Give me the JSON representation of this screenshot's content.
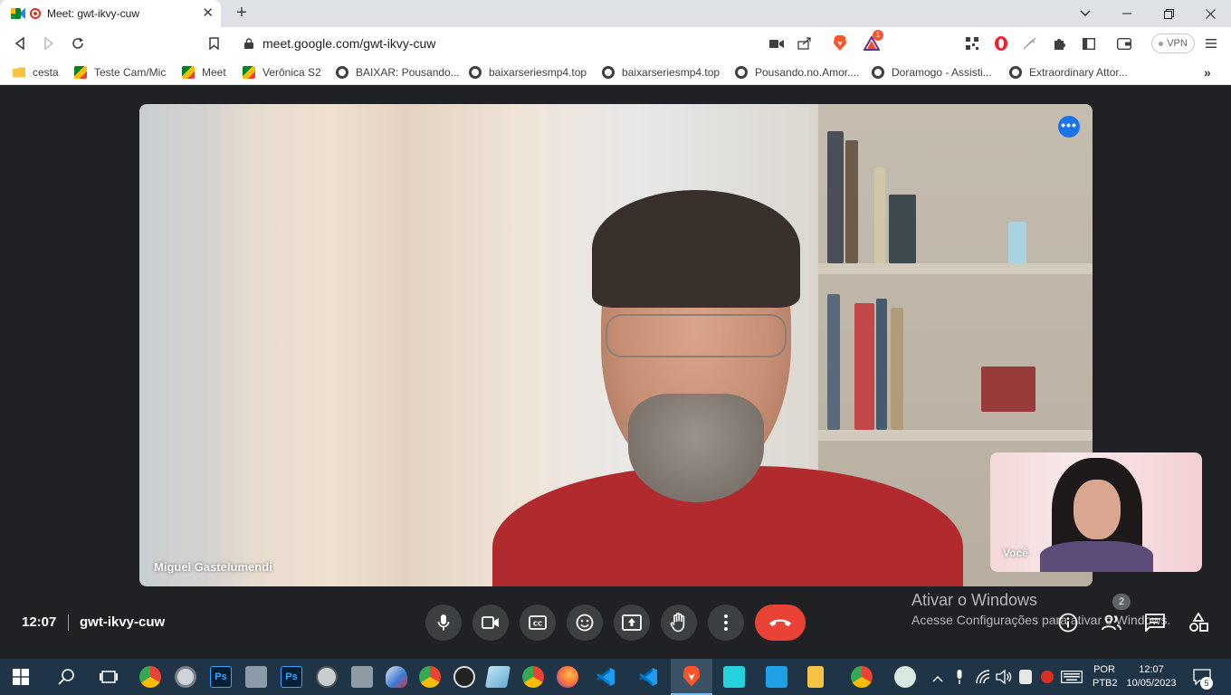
{
  "browser": {
    "tab_title": "Meet: gwt-ikvy-cuw",
    "tab_close": "✕",
    "new_tab": "+",
    "url": "meet.google.com/gwt-ikvy-cuw",
    "vpn_label": "VPN",
    "brave_rewards_count": "1"
  },
  "bookmarks": [
    {
      "label": "cesta",
      "icon": "folder-icon"
    },
    {
      "label": "Teste Cam/Mic",
      "icon": "meet-icon"
    },
    {
      "label": "Meet",
      "icon": "meet-icon"
    },
    {
      "label": "Verônica S2",
      "icon": "meet-icon"
    },
    {
      "label": "BAIXAR: Pousando...",
      "icon": "globe-icon"
    },
    {
      "label": "baixarseriesmp4.top",
      "icon": "globe-icon"
    },
    {
      "label": "baixarseriesmp4.top",
      "icon": "globe-icon"
    },
    {
      "label": "Pousando.no.Amor....",
      "icon": "globe-icon"
    },
    {
      "label": "Doramogo - Assisti...",
      "icon": "globe-icon"
    },
    {
      "label": "Extraordinary Attor...",
      "icon": "globe-icon"
    }
  ],
  "meet": {
    "main_participant": "Miguel Gastelumendi",
    "self_label": "Você",
    "time": "12:07",
    "meeting_code": "gwt-ikvy-cuw",
    "participant_count": "2"
  },
  "windows": {
    "activate_title": "Ativar o Windows",
    "activate_subtitle": "Acesse Configurações para ativar o Windows.",
    "lang_top": "POR",
    "lang_bottom": "PTB2",
    "clock_time": "12:07",
    "clock_date": "10/05/2023",
    "notifications_count": "5"
  },
  "colors": {
    "meet_background": "#202124",
    "control_button": "#3c4043",
    "end_call": "#ea4335",
    "accent_blue": "#1a73e8",
    "taskbar": "#1f3447"
  }
}
